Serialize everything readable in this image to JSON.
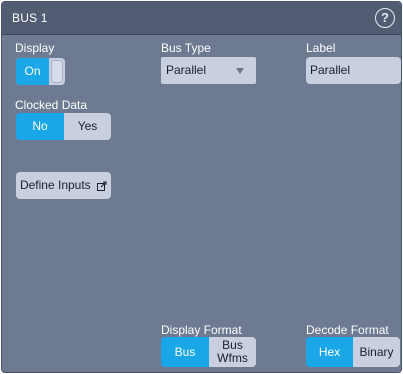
{
  "window": {
    "title": "BUS 1",
    "help_glyph": "?"
  },
  "display": {
    "label": "Display",
    "toggle_label": "On",
    "value": true
  },
  "bus_type": {
    "label": "Bus Type",
    "selected": "Parallel"
  },
  "label_field": {
    "label": "Label",
    "value": "Parallel"
  },
  "clocked_data": {
    "label": "Clocked Data",
    "options": [
      "No",
      "Yes"
    ],
    "selected": "No"
  },
  "define_inputs": {
    "label": "Define Inputs",
    "icon": "external-link-icon"
  },
  "display_format": {
    "label": "Display Format",
    "options": [
      "Bus",
      "Bus\nWfms"
    ],
    "selected": "Bus"
  },
  "decode_format": {
    "label": "Decode Format",
    "options": [
      "Hex",
      "Binary"
    ],
    "selected": "Hex"
  },
  "colors": {
    "panel": "#6d7a92",
    "titlebar": "#525d74",
    "accent": "#1aa7e8",
    "control": "#c8d0e0"
  }
}
